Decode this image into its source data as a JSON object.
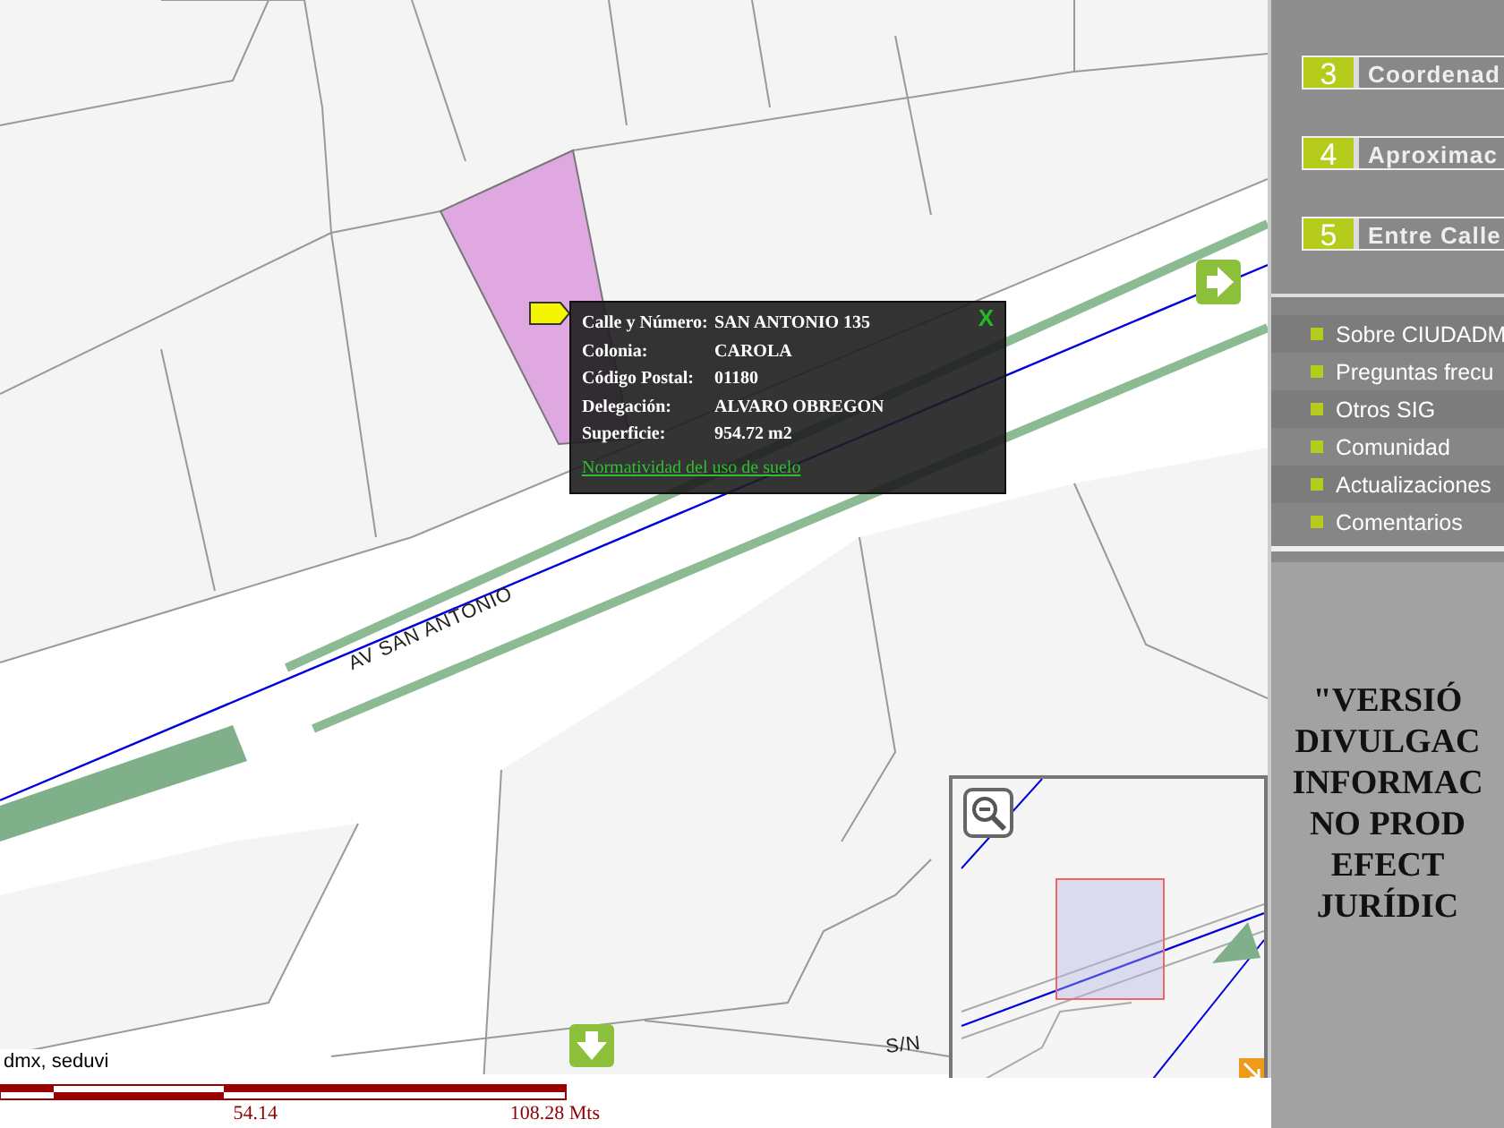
{
  "map": {
    "street_labels": [
      {
        "text": "AV SAN ANTONIO",
        "kind": "avenue"
      },
      {
        "text": "S/N",
        "kind": "minor"
      }
    ],
    "popup": {
      "fields": [
        {
          "label": "Calle y Número:",
          "value": "SAN ANTONIO 135"
        },
        {
          "label": "Colonia:",
          "value": "CAROLA"
        },
        {
          "label": "Código Postal:",
          "value": "01180"
        },
        {
          "label": "Delegación:",
          "value": "ALVARO OBREGON"
        },
        {
          "label": "Superficie:",
          "value": "954.72 m2"
        }
      ],
      "link": "Normatividad del uso de suelo",
      "close": "X"
    },
    "attribution": "dmx, seduvi"
  },
  "scale_bar": {
    "labels": [
      "54.14",
      "108.28 Mts"
    ]
  },
  "sidebar": {
    "search_options": [
      {
        "number": "3",
        "label": "Coordenad"
      },
      {
        "number": "4",
        "label": "Aproximac"
      },
      {
        "number": "5",
        "label": "Entre Calle"
      }
    ],
    "links": [
      "Sobre CIUDADM",
      "Preguntas frecu",
      "Otros SIG",
      "Comunidad",
      "Actualizaciones",
      "Comentarios"
    ],
    "disclaimer_lines": [
      "\"VERSIÓ",
      "DIVULGAC",
      "INFORMAC",
      "NO PROD",
      "EFECT",
      "JURÍDIC"
    ]
  }
}
